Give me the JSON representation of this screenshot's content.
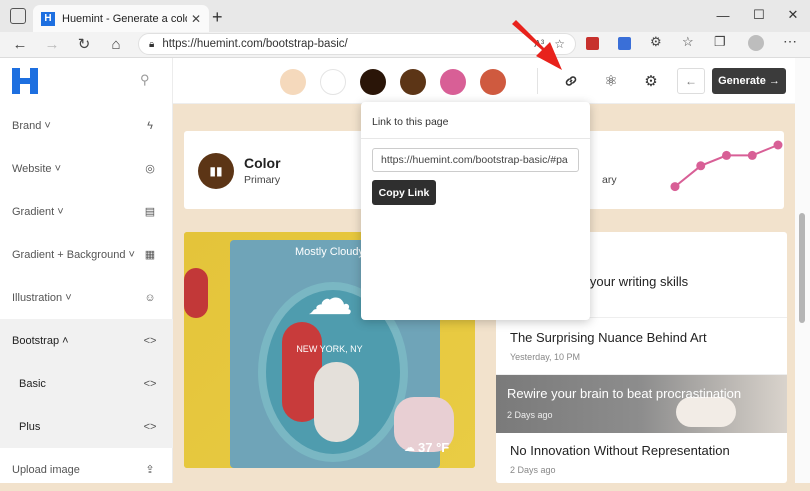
{
  "browser": {
    "tab_title": "Huemint - Generate a color pale",
    "url": "https://huemint.com/bootstrap-basic/",
    "reader_label": "A³"
  },
  "sidebar": {
    "items": [
      {
        "label": "Brand ˅",
        "icon": "lightning-icon"
      },
      {
        "label": "Website ˅",
        "icon": "compass-icon"
      },
      {
        "label": "Gradient ˅",
        "icon": "gradient-icon"
      },
      {
        "label": "Gradient + Background ˅",
        "icon": "gradient-bg-icon"
      },
      {
        "label": "Illustration ˅",
        "icon": "illustration-icon"
      },
      {
        "label": "Bootstrap ˄",
        "icon": "code-icon"
      },
      {
        "label": "Basic",
        "icon": "code-icon"
      },
      {
        "label": "Plus",
        "icon": "code-icon"
      },
      {
        "label": "Upload image",
        "icon": "upload-icon"
      }
    ]
  },
  "palette": {
    "colors": [
      "#f5d9bc",
      "#ffffff",
      "#2a1508",
      "#5c3516",
      "#d85f96",
      "#cf5a3f"
    ]
  },
  "toolbar": {
    "generate_label": "Generate →",
    "back_label": "←"
  },
  "popup": {
    "title": "Link to this page",
    "link_value": "https://huemint.com/bootstrap-basic/#pa",
    "copy_label": "Copy Link"
  },
  "color_card": {
    "title": "Color",
    "subtitle": "Primary",
    "subtitle_partial": "ary"
  },
  "weather": {
    "condition": "Mostly Cloudy",
    "location": "NEW YORK, NY",
    "temp": "37 °F"
  },
  "articles": [
    {
      "title": "rove your writing skills",
      "date": ""
    },
    {
      "title": "The Surprising Nuance Behind Art",
      "date": "Yesterday, 10 PM"
    },
    {
      "title": "Rewire your brain to beat procrastination",
      "date": "2 Days ago"
    },
    {
      "title": "No Innovation Without Representation",
      "date": "2 Days ago"
    }
  ],
  "chart_data": {
    "type": "line",
    "values": [
      1,
      3,
      4,
      4,
      5
    ]
  },
  "colors": {
    "accent": "#d85f96",
    "dark": "#3b3b3b",
    "background": "#f2e2cc"
  }
}
